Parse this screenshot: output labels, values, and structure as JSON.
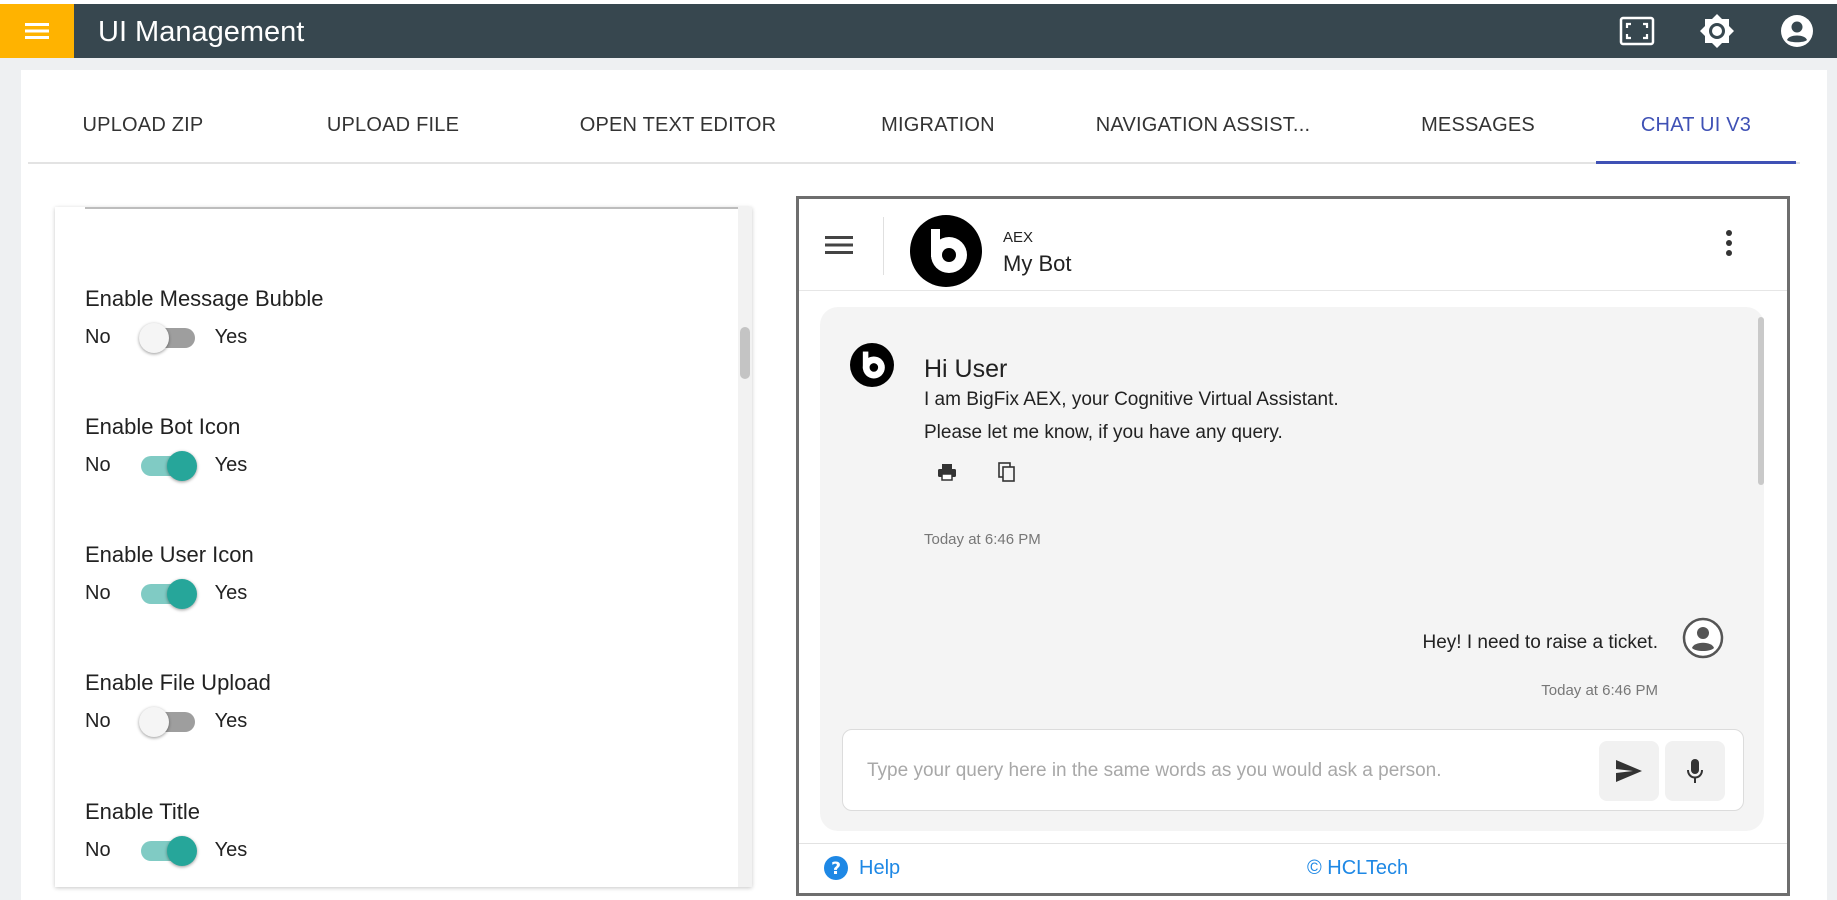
{
  "app": {
    "title": "UI Management"
  },
  "tabs": [
    {
      "label": "UPLOAD ZIP"
    },
    {
      "label": "UPLOAD FILE"
    },
    {
      "label": "OPEN TEXT EDITOR"
    },
    {
      "label": "MIGRATION"
    },
    {
      "label": "NAVIGATION ASSIST..."
    },
    {
      "label": "MESSAGES"
    },
    {
      "label": "CHAT UI V3",
      "active": true
    }
  ],
  "settings": [
    {
      "label": "Enable Message Bubble",
      "no": "No",
      "yes": "Yes",
      "enabled": false
    },
    {
      "label": "Enable Bot Icon",
      "no": "No",
      "yes": "Yes",
      "enabled": true
    },
    {
      "label": "Enable User Icon",
      "no": "No",
      "yes": "Yes",
      "enabled": true
    },
    {
      "label": "Enable File Upload",
      "no": "No",
      "yes": "Yes",
      "enabled": false
    },
    {
      "label": "Enable Title",
      "no": "No",
      "yes": "Yes",
      "enabled": true
    }
  ],
  "chat": {
    "bot_small": "AEX",
    "bot_name": "My Bot",
    "greeting": "Hi User",
    "line1": "I am BigFix AEX, your Cognitive Virtual Assistant.",
    "line2": "Please let me know, if you have any query.",
    "bot_time": "Today at 6:46 PM",
    "user_message": "Hey! I need to raise a ticket.",
    "user_time": "Today at 6:46 PM",
    "input_placeholder": "Type your query here in the same words as you would ask a person.",
    "help": "Help",
    "copyright": "© HCLTech"
  },
  "colors": {
    "topbar": "#37474f",
    "menu_button": "#ffb300",
    "tab_active": "#3f51b5",
    "toggle_on": "#26a69a",
    "link": "#1e88e5"
  }
}
